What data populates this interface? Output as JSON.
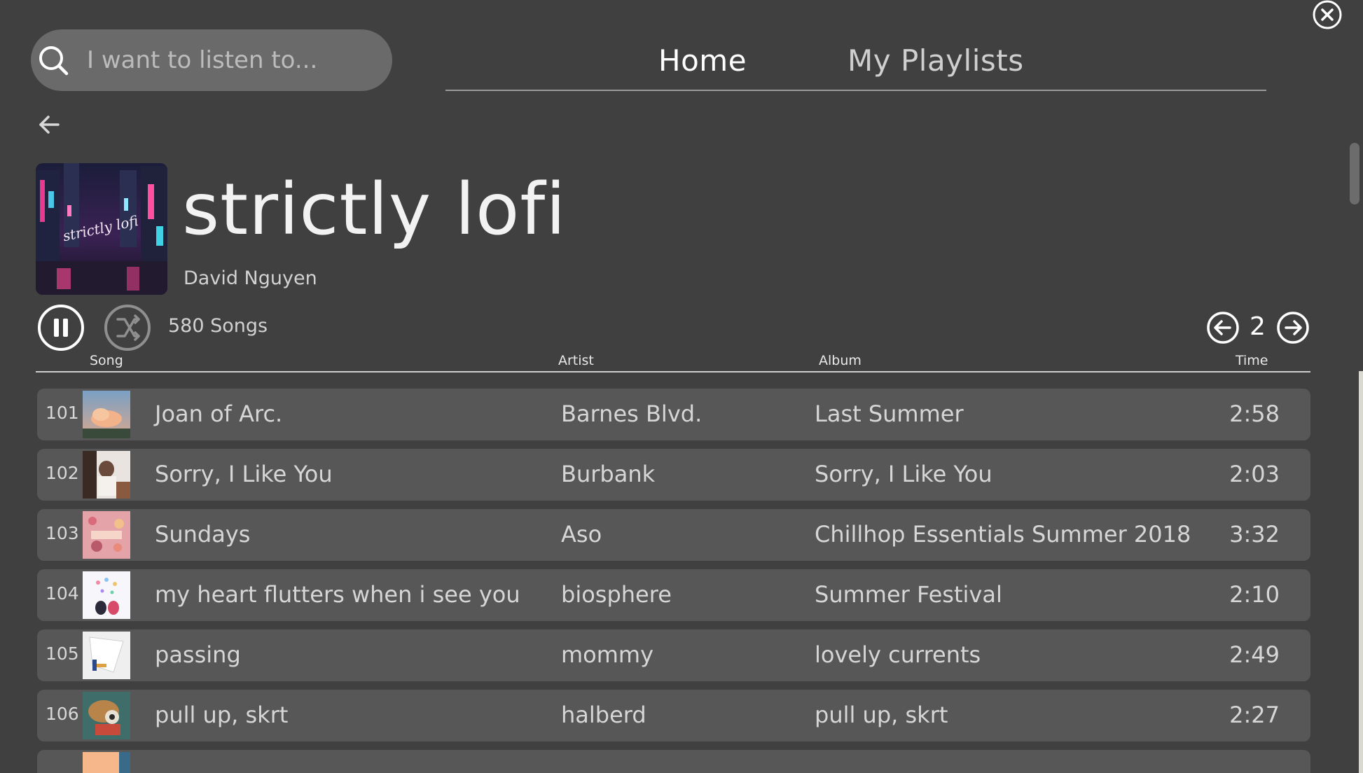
{
  "search": {
    "placeholder": "I want to listen to..."
  },
  "tabs": [
    {
      "label": "Home",
      "active": true
    },
    {
      "label": "My Playlists",
      "active": false
    }
  ],
  "playlist": {
    "title": "strictly lofi",
    "owner": "David Nguyen",
    "cover_text": "strictly lofi",
    "song_count": "580 Songs"
  },
  "pagination": {
    "current_page": "2"
  },
  "table": {
    "columns": [
      "Song",
      "Artist",
      "Album",
      "Time"
    ],
    "rows": [
      {
        "index": "101",
        "title": "Joan of Arc.",
        "artist": "Barnes Blvd.",
        "album": "Last Summer",
        "time": "2:58"
      },
      {
        "index": "102",
        "title": "Sorry, I Like You",
        "artist": "Burbank",
        "album": "Sorry, I Like You",
        "time": "2:03"
      },
      {
        "index": "103",
        "title": "Sundays",
        "artist": "Aso",
        "album": "Chillhop Essentials Summer 2018",
        "time": "3:32"
      },
      {
        "index": "104",
        "title": "my heart flutters when i see you",
        "artist": "biosphere",
        "album": "Summer Festival",
        "time": "2:10"
      },
      {
        "index": "105",
        "title": "passing",
        "artist": "mommy",
        "album": "lovely currents",
        "time": "2:49"
      },
      {
        "index": "106",
        "title": "pull up, skrt",
        "artist": "halberd",
        "album": "pull up, skrt",
        "time": "2:27"
      }
    ]
  },
  "colors": {
    "background": "#404040",
    "row_background": "#575757",
    "search_background": "#6a6a6a",
    "text": "#d6d6d6",
    "title_text": "#f2f2f2"
  },
  "icons": {
    "close": "close-icon",
    "search": "search-icon",
    "back": "arrow-left-icon",
    "pause": "pause-icon",
    "shuffle": "shuffle-icon",
    "prev_page": "arrow-left-circle-icon",
    "next_page": "arrow-right-circle-icon"
  }
}
